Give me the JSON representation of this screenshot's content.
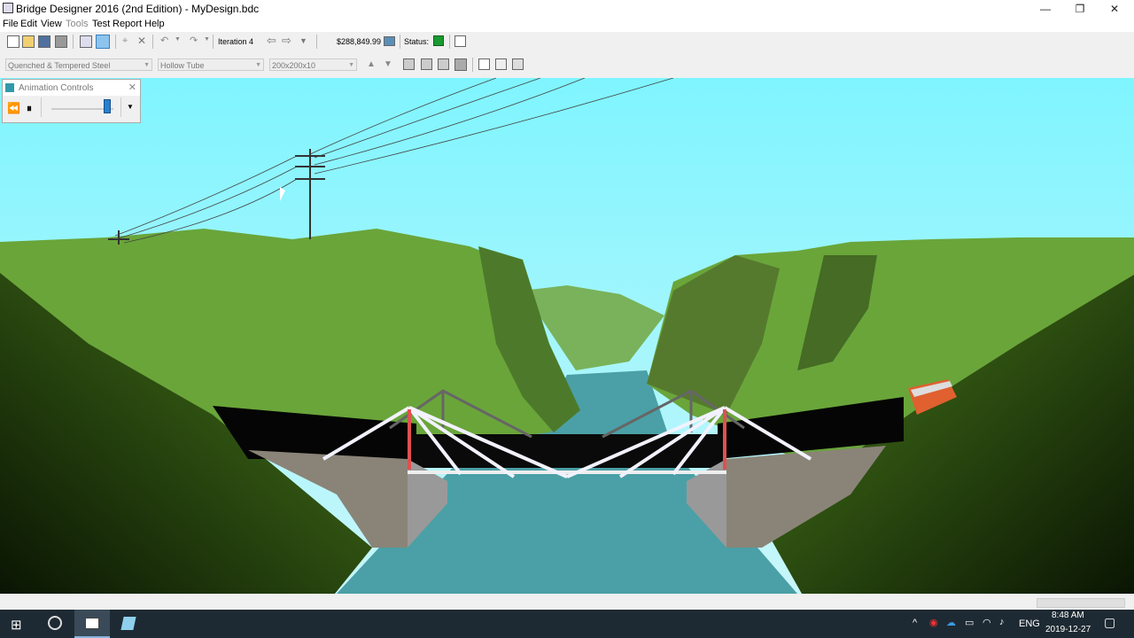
{
  "window": {
    "title": "Bridge Designer 2016 (2nd Edition) - MyDesign.bdc",
    "minimize": "—",
    "restore": "❐",
    "close": "✕"
  },
  "menu": [
    "File",
    "Edit",
    "View",
    "Tools",
    "Test",
    "Report",
    "Help"
  ],
  "toolbar": {
    "iteration": "Iteration 4",
    "cost": "$288,849.99",
    "status_label": "Status:"
  },
  "selectors": {
    "material": "Quenched & Tempered Steel",
    "section": "Hollow Tube",
    "size": "200x200x10"
  },
  "animation_controls": {
    "title": "Animation Controls",
    "slider_value": 0.9
  },
  "taskbar": {
    "lang": "ENG",
    "time": "8:48 AM",
    "date": "2019-12-27"
  },
  "colors": {
    "sky_top": "#7ff5ff",
    "sky_bottom": "#c8f6fa",
    "grass": "#6aa53a",
    "water": "#4aa0a6",
    "tension_member": "#f2f2ff",
    "compression_member": "#e05050"
  }
}
